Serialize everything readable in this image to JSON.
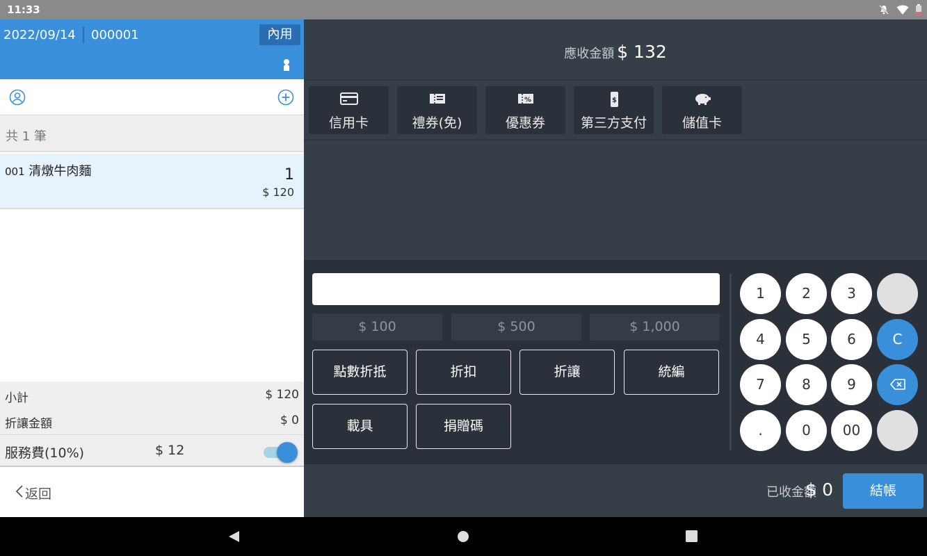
{
  "status_bar": {
    "time": "11:33"
  },
  "order": {
    "date": "2022/09/14",
    "number": "000001",
    "dine_mode": "內用"
  },
  "list": {
    "count_label": "共 1 筆",
    "items": [
      {
        "code": "001",
        "name": "清燉牛肉麵",
        "qty": "1",
        "price": "$ 120"
      }
    ]
  },
  "summary": {
    "subtotal_label": "小計",
    "subtotal_value": "$ 120",
    "discount_label": "折讓金額",
    "discount_value": "$ 0",
    "service_label": "服務費(10%)",
    "service_value": "$ 12",
    "service_enabled": true
  },
  "back_label": "返回",
  "payment": {
    "due_label": "應收金額",
    "due_amount": "$ 132",
    "methods": [
      {
        "label": "信用卡",
        "icon": "credit-card-icon"
      },
      {
        "label": "禮券(免)",
        "icon": "gift-voucher-icon"
      },
      {
        "label": "優惠券",
        "icon": "coupon-icon"
      },
      {
        "label": "第三方支付",
        "icon": "mobile-payment-icon"
      },
      {
        "label": "儲值卡",
        "icon": "piggy-bank-icon"
      }
    ],
    "amount_input_value": "",
    "quick_amounts": [
      "$ 100",
      "$ 500",
      "$ 1,000"
    ],
    "functions": [
      "點數折抵",
      "折扣",
      "折讓",
      "統編",
      "載具",
      "捐贈碼"
    ],
    "keypad": [
      "1",
      "2",
      "3",
      "",
      "4",
      "5",
      "6",
      "C",
      "7",
      "8",
      "9",
      "backspace",
      ".",
      "0",
      "00",
      ""
    ],
    "paid_label": "已收金額",
    "paid_amount": "$ 0",
    "checkout_label": "結帳"
  },
  "colors": {
    "accent": "#3a8fdb",
    "panel_dark": "#363e48",
    "button_dark": "#2a313b",
    "item_highlight": "#e6f3fd"
  }
}
